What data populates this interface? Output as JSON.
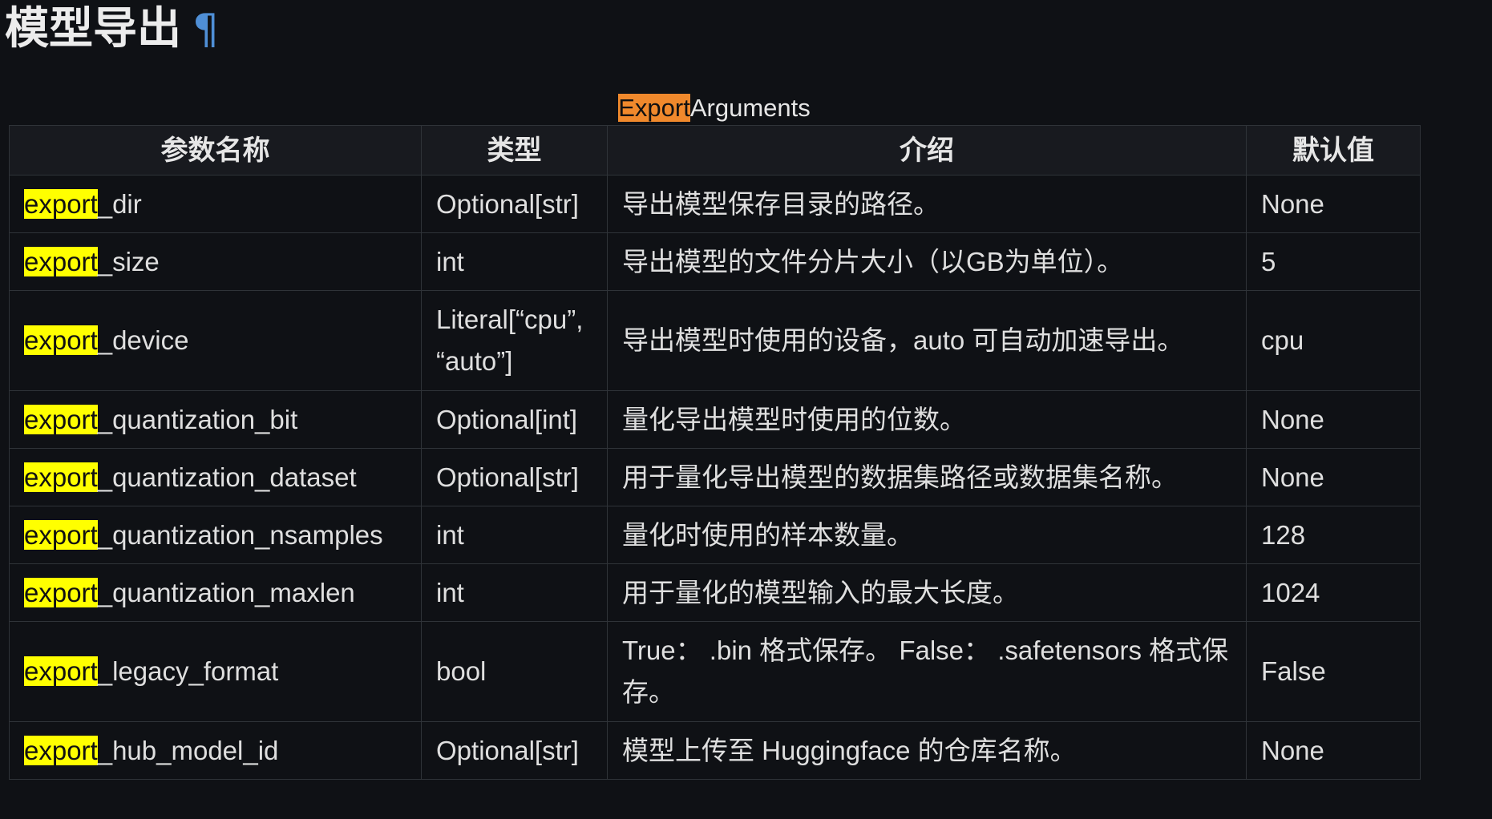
{
  "page": {
    "title": "模型导出",
    "anchor_symbol": "¶"
  },
  "table": {
    "caption_highlight": "Export",
    "caption_rest": "Arguments",
    "headers": [
      "参数名称",
      "类型",
      "介绍",
      "默认值"
    ],
    "highlight_prefix": "export",
    "rows": [
      {
        "name_suffix": "_dir",
        "type": "Optional[str]",
        "description": "导出模型保存目录的路径。",
        "default": "None"
      },
      {
        "name_suffix": "_size",
        "type": "int",
        "description": "导出模型的文件分片大小（以GB为单位）。",
        "default": "5"
      },
      {
        "name_suffix": "_device",
        "type": "Literal[“cpu”, “auto”]",
        "description": "导出模型时使用的设备，auto 可自动加速导出。",
        "default": "cpu"
      },
      {
        "name_suffix": "_quantization_bit",
        "type": "Optional[int]",
        "description": "量化导出模型时使用的位数。",
        "default": "None"
      },
      {
        "name_suffix": "_quantization_dataset",
        "type": "Optional[str]",
        "description": "用于量化导出模型的数据集路径或数据集名称。",
        "default": "None"
      },
      {
        "name_suffix": "_quantization_nsamples",
        "type": "int",
        "description": "量化时使用的样本数量。",
        "default": "128"
      },
      {
        "name_suffix": "_quantization_maxlen",
        "type": "int",
        "description": "用于量化的模型输入的最大长度。",
        "default": "1024"
      },
      {
        "name_suffix": "_legacy_format",
        "type": "bool",
        "description": "True： .bin 格式保存。 False： .safetensors 格式保存。",
        "default": "False"
      },
      {
        "name_suffix": "_hub_model_id",
        "type": "Optional[str]",
        "description": "模型上传至 Huggingface 的仓库名称。",
        "default": "None"
      }
    ]
  },
  "colors": {
    "background": "#0f1115",
    "caption_highlight": "#f0892c",
    "search_highlight": "#ffff00",
    "anchor": "#4f8fd6"
  }
}
